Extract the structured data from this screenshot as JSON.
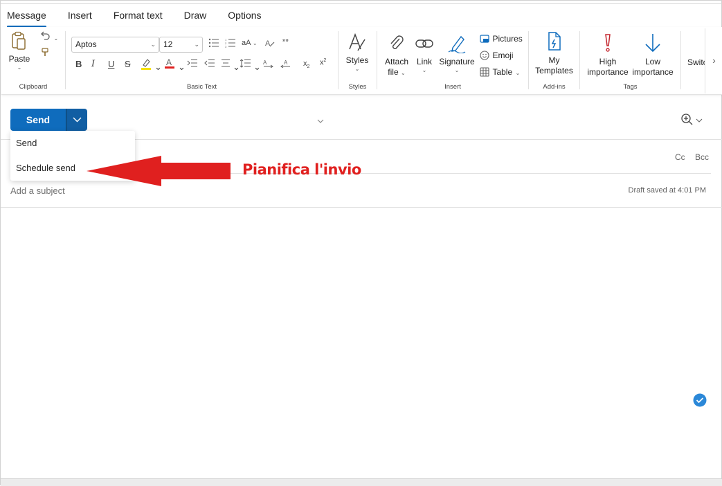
{
  "tabs": [
    "Message",
    "Insert",
    "Format text",
    "Draw",
    "Options"
  ],
  "ribbon": {
    "clipboard": {
      "paste": "Paste",
      "group": "Clipboard"
    },
    "basic_text": {
      "font": "Aptos",
      "size": "12",
      "group": "Basic Text"
    },
    "styles": {
      "label": "Styles",
      "group": "Styles"
    },
    "insert": {
      "attach": "Attach",
      "attach2": "file",
      "link": "Link",
      "signature": "Signature",
      "pictures": "Pictures",
      "emoji": "Emoji",
      "table": "Table",
      "group": "Insert"
    },
    "addins": {
      "label1": "My",
      "label2": "Templates",
      "group": "Add-ins"
    },
    "tags": {
      "high1": "High",
      "high2": "importance",
      "low1": "Low",
      "low2": "importance",
      "group": "Tags"
    },
    "switch": "Switc"
  },
  "send": {
    "label": "Send"
  },
  "menu": {
    "items": [
      "Send",
      "Schedule send"
    ]
  },
  "fields": {
    "cc": "Cc",
    "bcc": "Bcc",
    "subject_placeholder": "Add a subject",
    "draft_status": "Draft saved at 4:01 PM"
  },
  "annotation": {
    "text": "Pianifica l'invio"
  },
  "colors": {
    "accent": "#0f6cbd",
    "annotation": "#e0201f",
    "highlight": "#f5e100",
    "font_color": "#e0201f",
    "check": "#2b88d8"
  }
}
